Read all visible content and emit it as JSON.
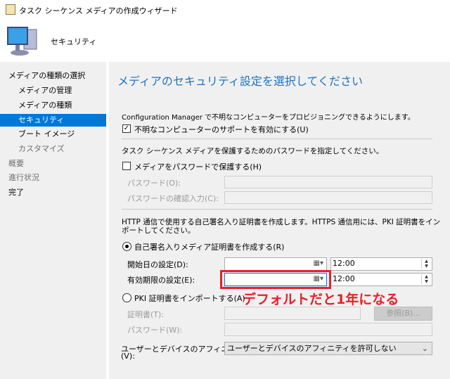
{
  "window": {
    "title": "タスク シーケンス メディアの作成ウィザード",
    "icon": "wizard-icon"
  },
  "header": {
    "page_name": "セキュリティ",
    "icon": "computer-icon"
  },
  "nav": {
    "items": [
      {
        "label": "メディアの種類の選択",
        "level": 0,
        "state": "normal"
      },
      {
        "label": "メディアの管理",
        "level": 1,
        "state": "normal"
      },
      {
        "label": "メディアの種類",
        "level": 1,
        "state": "normal"
      },
      {
        "label": "セキュリティ",
        "level": 1,
        "state": "selected"
      },
      {
        "label": "ブート イメージ",
        "level": 1,
        "state": "normal"
      },
      {
        "label": "カスタマイズ",
        "level": 1,
        "state": "dim"
      },
      {
        "label": "概要",
        "level": 0,
        "state": "dim"
      },
      {
        "label": "進行状況",
        "level": 0,
        "state": "dim"
      },
      {
        "label": "完了",
        "level": 0,
        "state": "normal"
      }
    ]
  },
  "main": {
    "heading": "メディアのセキュリティ設定を選択してください",
    "unknown_desc": "Configuration Manager で不明なコンピューターをプロビジョニングできるようにします。",
    "unknown_checkbox": {
      "label": "不明なコンピューターのサポートを有効にする(U)",
      "checked": true
    },
    "password_desc": "タスク シーケンス メディアを保護するためのパスワードを指定してください。",
    "password_checkbox": {
      "label": "メディアをパスワードで保護する(H)",
      "checked": false
    },
    "password_label": "パスワード(O):",
    "password_value": "",
    "confirm_label": "パスワードの確認入力(C):",
    "confirm_value": "",
    "cert_desc_1": "HTTP 通信で使用する自己署名入り証明書を作成します。HTTPS 通信用には、PKI 証明書をイン",
    "cert_desc_2": "ポートしてください。",
    "self_signed_radio": {
      "label": "自己署名入りメディア証明書を作成する(R)",
      "selected": true
    },
    "start_label": "開始日の設定(D):",
    "start_date": "",
    "start_time": "12:00",
    "expiry_label": "有効期限の設定(E):",
    "expiry_date": "",
    "expiry_time": "12:00",
    "pki_radio": {
      "label": "PKI 証明書をインポートする(A)",
      "selected": false
    },
    "cert_label": "証明書(T):",
    "cert_value": "",
    "browse_label": "参照(B)...",
    "pki_password_label": "パスワード(W):",
    "pki_password_value": "",
    "affinity_label_1": "ユーザーとデバイスのアフィニティ",
    "affinity_label_2": "(V):",
    "affinity_value": "ユーザーとデバイスのアフィニティを許可しない"
  },
  "annotation": {
    "text": "デフォルトだと1年になる",
    "color": "#e8202a"
  },
  "colors": {
    "accent": "#0078d7",
    "heading": "#1e73be"
  }
}
